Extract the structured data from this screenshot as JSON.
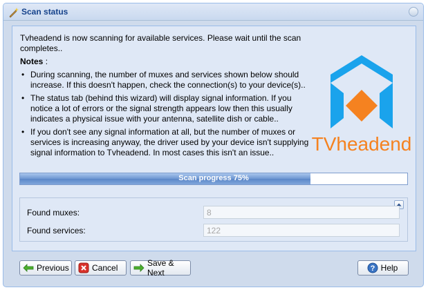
{
  "window": {
    "title": "Scan status"
  },
  "intro": "Tvheadend is now scanning for available services. Please wait until the scan completes..",
  "notes_title": "Notes",
  "notes_colon": ":",
  "notes": [
    "During scanning, the number of muxes and services shown below should increase. If this doesn't happen, check the connection(s) to your device(s)..",
    "The status tab (behind this wizard) will display signal information. If you notice a lot of errors or the signal strength appears low then this usually indicates a physical issue with your antenna, satellite dish or cable..",
    "If you don't see any signal information at all, but the number of muxes or services is increasing anyway, the driver used by your device isn't supplying signal information to Tvheadend. In most cases this isn't an issue.."
  ],
  "logo_text": "TVheadend",
  "progress": {
    "label": "Scan progress 75%",
    "percent": 75
  },
  "fields": {
    "muxes": {
      "label": "Found muxes:",
      "value": "8"
    },
    "services": {
      "label": "Found services:",
      "value": "122"
    }
  },
  "buttons": {
    "previous": "Previous",
    "cancel": "Cancel",
    "save_next": "Save & Next",
    "help": "Help"
  },
  "colors": {
    "logo_blue": "#1aa3ec",
    "logo_orange": "#f58220",
    "header_text": "#15428b"
  }
}
